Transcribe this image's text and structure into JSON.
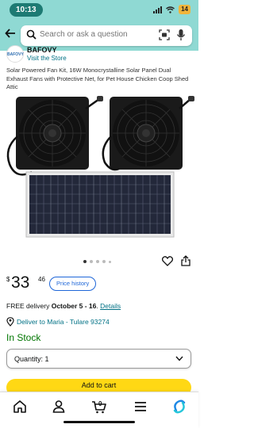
{
  "status": {
    "time": "10:13",
    "battery": "14"
  },
  "search": {
    "placeholder": "Search or ask a question"
  },
  "brand": {
    "logo_text": "BAFOVY",
    "name": "BAFOVY",
    "visit_store": "Visit the Store"
  },
  "product": {
    "title": "Solar Powered Fan Kit, 16W Monocrystalline Solar Panel Dual Exhaust Fans with Protective Net, for Pet House Chicken Coop Shed Attic",
    "image_count": 5,
    "current_image": 1
  },
  "price": {
    "symbol": "$",
    "whole": "33",
    "fraction": "46",
    "history_label": "Price history"
  },
  "delivery": {
    "prefix": "FREE delivery",
    "dates": "October 5 - 16",
    "sep": ". ",
    "details": "Details"
  },
  "location": {
    "text": "Deliver to Maria - Tulare 93274"
  },
  "stock": {
    "text": "In Stock"
  },
  "quantity": {
    "label": "Quantity: 1"
  },
  "cart": {
    "label": "Add to cart"
  },
  "nav": {
    "items": [
      {
        "icon": "home-icon"
      },
      {
        "icon": "account-icon"
      },
      {
        "icon": "cart-icon",
        "count": "0"
      },
      {
        "icon": "menu-icon"
      },
      {
        "icon": "rufus-icon"
      }
    ]
  },
  "colors": {
    "header_bg": "#8fd9d3",
    "link": "#007185",
    "in_stock": "#007600",
    "cart_button": "#FFD814",
    "price_history": "#1e66d8"
  }
}
